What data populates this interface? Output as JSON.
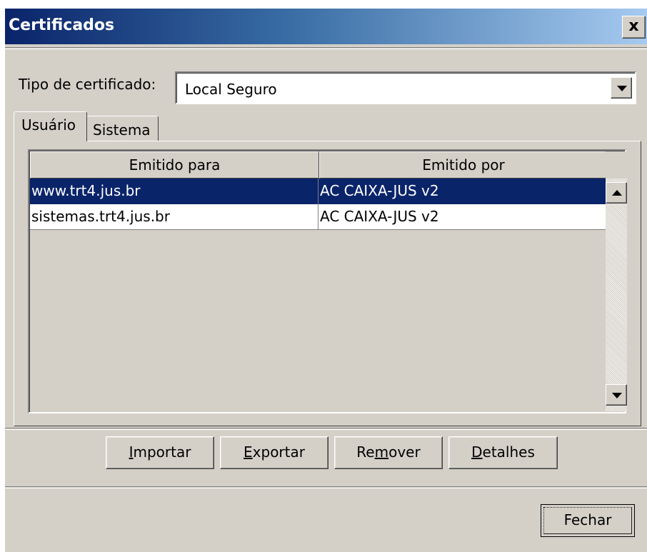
{
  "window": {
    "title": "Certificados",
    "close_label": "x"
  },
  "tipo": {
    "label": "Tipo de certificado:",
    "selected": "Local Seguro"
  },
  "tabs": [
    {
      "label": "Usuário",
      "active": true
    },
    {
      "label": "Sistema",
      "active": false
    }
  ],
  "table": {
    "columns": [
      "Emitido para",
      "Emitido por"
    ],
    "rows": [
      {
        "issued_to": "www.trt4.jus.br",
        "issued_by": "AC CAIXA-JUS v2",
        "selected": true
      },
      {
        "issued_to": "sistemas.trt4.jus.br",
        "issued_by": "AC CAIXA-JUS v2",
        "selected": false
      }
    ]
  },
  "actions": {
    "importar": {
      "label": "Importar",
      "access_key": "I"
    },
    "exportar": {
      "label": "Exportar",
      "access_key": "E"
    },
    "remover": {
      "label": "Remover",
      "access_key": "m"
    },
    "detalhes": {
      "label": "Detalhes",
      "access_key": "D"
    }
  },
  "footer": {
    "fechar_label": "Fechar"
  },
  "colors": {
    "title_start": "#0a246a",
    "title_end": "#a6caf0",
    "selection": "#0a246a",
    "face": "#d4d0c8"
  }
}
